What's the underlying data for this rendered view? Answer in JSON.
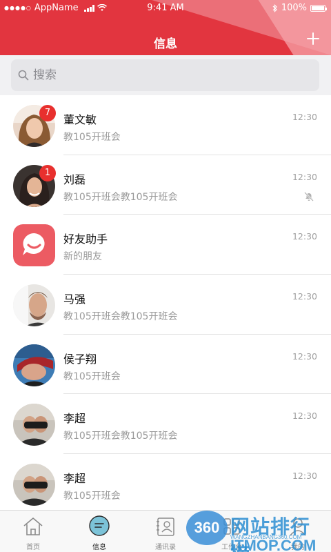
{
  "status_bar": {
    "carrier": "AppName",
    "time": "9:41 AM",
    "battery": "100%"
  },
  "header": {
    "title": "信息",
    "add_icon": "plus-icon"
  },
  "search": {
    "placeholder": "搜索",
    "icon": "search-icon"
  },
  "conversations": [
    {
      "name": "董文敏",
      "message": "教105开班会",
      "time": "12:30",
      "badge": "7",
      "muted": false
    },
    {
      "name": "刘磊",
      "message": "教105开班会教105开班会",
      "time": "12:30",
      "badge": "1",
      "muted": true
    },
    {
      "name": "好友助手",
      "message": "新的朋友",
      "time": "12:30",
      "badge": "",
      "muted": false
    },
    {
      "name": "马强",
      "message": "教105开班会教105开班会",
      "time": "12:30",
      "badge": "",
      "muted": false
    },
    {
      "name": "侯子翔",
      "message": "教105开班会",
      "time": "12:30",
      "badge": "",
      "muted": false
    },
    {
      "name": "李超",
      "message": "教105开班会教105开班会",
      "time": "12:30",
      "badge": "",
      "muted": false
    },
    {
      "name": "李超",
      "message": "教105开班会",
      "time": "12:30",
      "badge": "",
      "muted": false
    }
  ],
  "tabbar": {
    "tabs": [
      {
        "label": "首页",
        "icon": "home-icon",
        "active": false
      },
      {
        "label": "信息",
        "icon": "message-icon",
        "active": true
      },
      {
        "label": "通讯录",
        "icon": "contacts-icon",
        "active": false
      },
      {
        "label": "工作台",
        "icon": "workbench-icon",
        "active": false
      },
      {
        "label": "我的",
        "icon": "profile-icon",
        "active": false
      }
    ]
  },
  "watermark": {
    "logo": "360",
    "title": "网站排行榜",
    "domain": "ITMOP.COM",
    "sub": "WANGZHANBANG360.COM"
  },
  "colors": {
    "accent": "#e2353f",
    "badge": "#e8302e",
    "helper_avatar": "#ec5b63"
  }
}
